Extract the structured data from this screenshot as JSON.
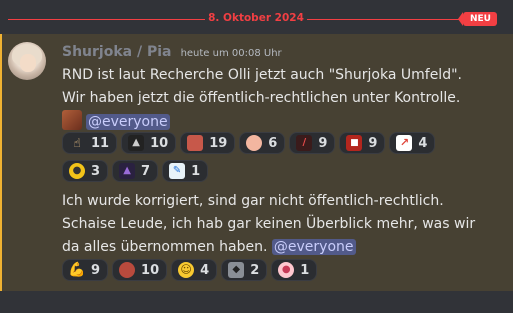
{
  "divider": {
    "date": "8. Oktober 2024",
    "badge": "NEU"
  },
  "message": {
    "username": "Shurjoka / Pia",
    "timestamp": "heute um 00:08 Uhr",
    "lines": [
      "RND ist laut Recherche Olli jetzt auch \"Shurjoka Umfeld\".",
      "Wir haben jetzt die öffentlich-rechtlichen unter Kontrolle."
    ],
    "mention": "@everyone",
    "reactions_row1": [
      {
        "icon": "pointing-hand-icon",
        "count": "11"
      },
      {
        "icon": "dark-emote-icon",
        "count": "10"
      },
      {
        "icon": "mouth-emote-icon",
        "count": "19"
      },
      {
        "icon": "pig-emote-icon",
        "count": "6"
      },
      {
        "icon": "sword-emote-icon",
        "count": "9"
      },
      {
        "icon": "red-emote-icon",
        "count": "9"
      },
      {
        "icon": "chart-increasing-icon",
        "count": "4"
      }
    ],
    "reactions_row2": [
      {
        "icon": "bird-emote-icon",
        "count": "3"
      },
      {
        "icon": "cave-emote-icon",
        "count": "7"
      },
      {
        "icon": "pencil-emote-icon",
        "count": "1"
      }
    ]
  },
  "message2": {
    "lines": [
      "Ich wurde korrigiert, sind gar nicht öffentlich-rechtlich.",
      "Schaise Leude, ich hab gar keinen Überblick mehr, was wir",
      "da alles übernommen haben."
    ],
    "mention": "@everyone",
    "reactions": [
      {
        "icon": "flexed-biceps-icon",
        "count": "9"
      },
      {
        "icon": "mouth-emote-icon",
        "count": "10"
      },
      {
        "icon": "rolling-laughing-icon",
        "count": "4"
      },
      {
        "icon": "gray-emote-icon",
        "count": "2"
      },
      {
        "icon": "pink-emote-icon",
        "count": "1"
      }
    ]
  },
  "colors": {
    "accent": "#f23f43",
    "highlight_bg": "#474133",
    "mention_bar": "#f0b232",
    "mention_bg": "#525a8a"
  }
}
